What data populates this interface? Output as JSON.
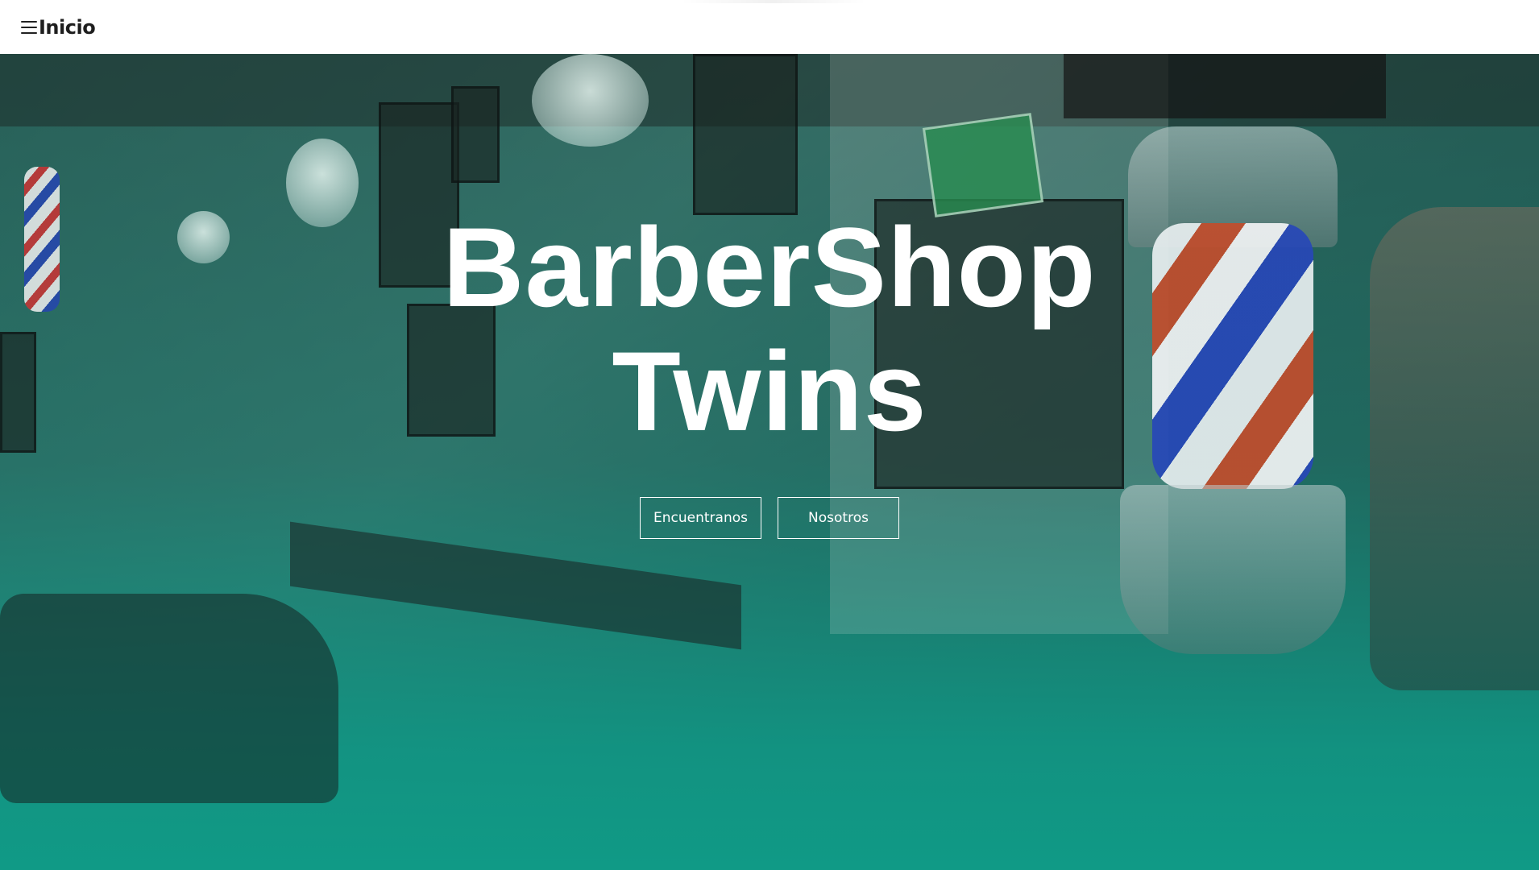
{
  "nav": {
    "menu_icon": "hamburger-menu-icon",
    "title": "Inicio"
  },
  "hero": {
    "title_line1": "BarberShop",
    "title_line2": "Twins",
    "buttons": [
      {
        "label": "Encuentranos"
      },
      {
        "label": "Nosotros"
      }
    ],
    "background_image": "barbershop interior photo with teal overlay",
    "overlay_color": "#109a86",
    "text_color": "#ffffff"
  }
}
